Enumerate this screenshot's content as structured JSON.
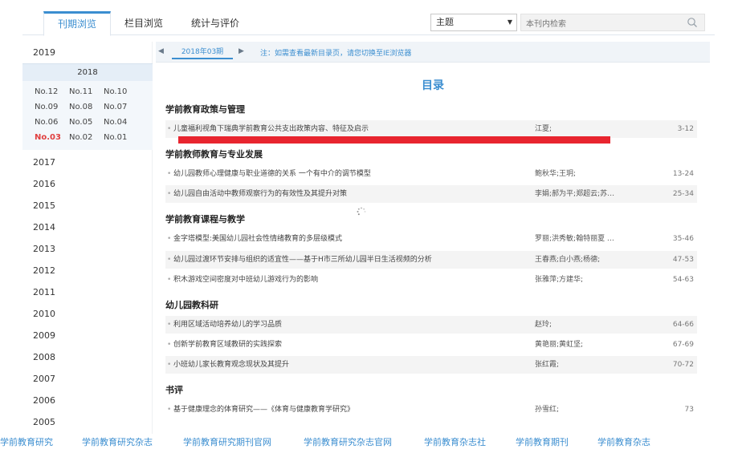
{
  "tabs": [
    {
      "label": "刊期浏览",
      "active": true
    },
    {
      "label": "栏目浏览",
      "active": false
    },
    {
      "label": "统计与评价",
      "active": false
    }
  ],
  "search": {
    "select_value": "主题",
    "placeholder": "本刊内检索"
  },
  "sidebar": {
    "years_before": [
      "2019"
    ],
    "open_year": "2018",
    "issues": [
      "No.12",
      "No.11",
      "No.10",
      "No.09",
      "No.08",
      "No.07",
      "No.06",
      "No.05",
      "No.04",
      "No.03",
      "No.02",
      "No.01"
    ],
    "current_issue": "No.03",
    "years_after": [
      "2017",
      "2016",
      "2015",
      "2014",
      "2013",
      "2012",
      "2011",
      "2010",
      "2009",
      "2008",
      "2007",
      "2006",
      "2005"
    ]
  },
  "issuebar": {
    "issue_label": "2018年03期",
    "note": "注：如需查看最新目录页，请您切换至IE浏览器"
  },
  "toc": {
    "title": "目录",
    "sections": [
      {
        "title": "学前教育政策与管理",
        "articles": [
          {
            "title": "儿童福利视角下瑞典学前教育公共支出政策内容、特征及启示",
            "authors": "江夏;",
            "pages": "3-12"
          }
        ]
      },
      {
        "title": "学前教师教育与专业发展",
        "articles": [
          {
            "title": "幼儿园教师心理健康与职业道德的关系 一个有中介的调节模型",
            "authors": "鲍秋华;王玥;",
            "pages": "13-24"
          },
          {
            "title": "幼儿园自由活动中教师观察行为的有效性及其提升对策",
            "authors": "李娟;郝为平;郑超云;苏…",
            "pages": "25-34"
          }
        ]
      },
      {
        "title": "学前教育课程与教学",
        "articles": [
          {
            "title": "金字塔模型:美国幼儿园社会性情绪教育的多层级模式",
            "authors": "罗丽;洪秀敏;翰特丽夏 …",
            "pages": "35-46"
          },
          {
            "title": "幼儿园过渡环节安排与组织的适宜性——基于H市三所幼儿园半日生活视频的分析",
            "authors": "王春燕;白小燕;杨德;",
            "pages": "47-53"
          },
          {
            "title": "积木游戏空间密度对中班幼儿游戏行为的影响",
            "authors": "张雅萍;方建华;",
            "pages": "54-63"
          }
        ]
      },
      {
        "title": "幼儿园教科研",
        "articles": [
          {
            "title": "利用区域活动培养幼儿的学习品质",
            "authors": "赵玲;",
            "pages": "64-66"
          },
          {
            "title": "创新学前教育区域教研的实践探索",
            "authors": "黄艳丽;黄虹坚;",
            "pages": "67-69"
          },
          {
            "title": "小班幼儿家长教育观念现状及其提升",
            "authors": "张红霞;",
            "pages": "70-72"
          }
        ]
      },
      {
        "title": "书评",
        "articles": [
          {
            "title": "基于健康理念的体育研究——《体育与健康教育学研究》",
            "authors": "孙雪红;",
            "pages": "73"
          }
        ]
      }
    ]
  },
  "bottom_links": [
    "学前教育研究",
    "学前教育研究杂志",
    "学前教育研究期刊官网",
    "学前教育研究杂志官网",
    "学前教育杂志社",
    "学前教育期刊",
    "学前教育杂志"
  ],
  "colors": {
    "accent": "#3b8ed0",
    "current_issue": "#e04040",
    "redline": "#e8252f"
  }
}
